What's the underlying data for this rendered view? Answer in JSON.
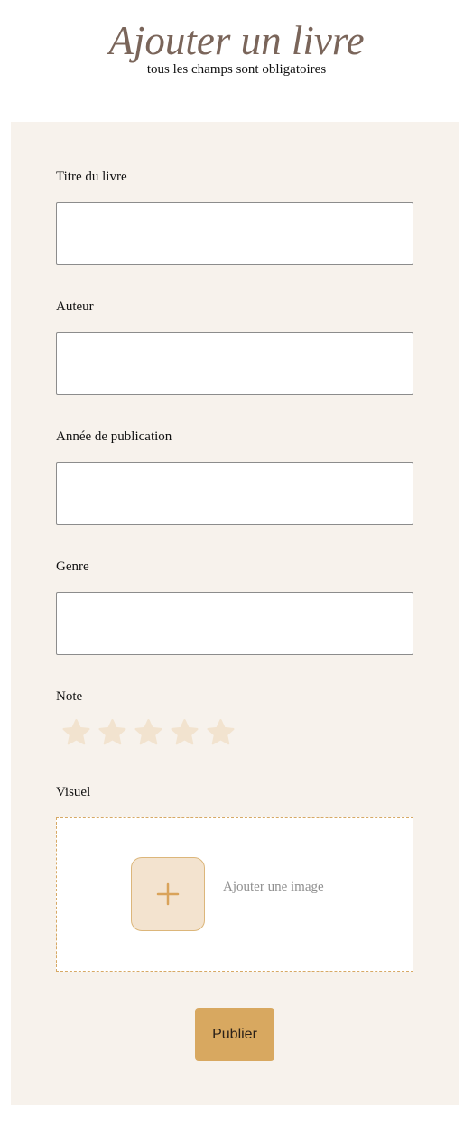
{
  "header": {
    "title": "Ajouter un livre",
    "subtitle": "tous les champs sont obligatoires"
  },
  "form": {
    "fields": [
      {
        "label": "Titre du livre",
        "value": ""
      },
      {
        "label": "Auteur",
        "value": ""
      },
      {
        "label": "Année de publication",
        "value": ""
      },
      {
        "label": "Genre",
        "value": ""
      }
    ],
    "rating": {
      "label": "Note",
      "max": 5,
      "value": 0
    },
    "upload": {
      "label": "Visuel",
      "prompt": "Ajouter une image",
      "icon": "plus-icon"
    },
    "submit_label": "Publier"
  },
  "colors": {
    "title": "#7a655a",
    "card_background": "#f7f2ec",
    "star_empty": "#f2e3cf",
    "accent": "#d8a860",
    "upload_border": "#d7a965"
  }
}
